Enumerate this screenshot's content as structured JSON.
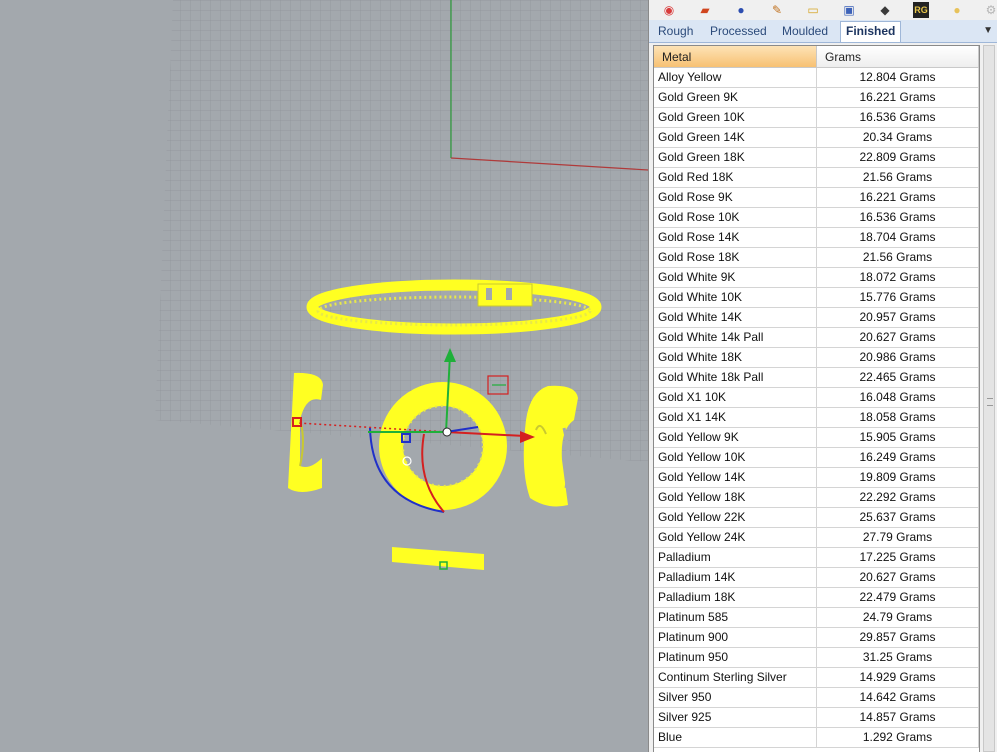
{
  "viewport": {
    "background": "#a3a8ad",
    "grid_color": "#8f9499",
    "object_color": "#ffff22"
  },
  "toolbar": {
    "icons": [
      {
        "name": "color-wheel-icon",
        "glyph": "◉",
        "color": "#d83b3b"
      },
      {
        "name": "box-icon",
        "glyph": "▰",
        "color": "#d0451e"
      },
      {
        "name": "sphere-render-icon",
        "glyph": "●",
        "color": "#2c4db0"
      },
      {
        "name": "paint-brush-icon",
        "glyph": "✎",
        "color": "#c0711e"
      },
      {
        "name": "folder-icon",
        "glyph": "▭",
        "color": "#d6a628"
      },
      {
        "name": "monitor-icon",
        "glyph": "▣",
        "color": "#3d62b8"
      },
      {
        "name": "gem-icon",
        "glyph": "◆",
        "color": "#3a3a3a"
      },
      {
        "name": "rg-logo-icon",
        "glyph": "RG",
        "color": "#e8c64a"
      },
      {
        "name": "gold-sphere-icon",
        "glyph": "●",
        "color": "#e7c25a"
      },
      {
        "name": "settings-icon",
        "glyph": "⚙",
        "color": "#b5b5b5"
      }
    ]
  },
  "tabs": [
    {
      "label": "Rough",
      "active": false
    },
    {
      "label": "Processed",
      "active": false
    },
    {
      "label": "Moulded",
      "active": false
    },
    {
      "label": "Finished",
      "active": true
    }
  ],
  "table": {
    "columns": [
      "Metal",
      "Grams"
    ],
    "rows": [
      [
        "Alloy Yellow",
        "12.804 Grams"
      ],
      [
        "Gold Green 9K",
        "16.221 Grams"
      ],
      [
        "Gold Green 10K",
        "16.536 Grams"
      ],
      [
        "Gold Green 14K",
        "20.34 Grams"
      ],
      [
        "Gold Green 18K",
        "22.809 Grams"
      ],
      [
        "Gold Red 18K",
        "21.56 Grams"
      ],
      [
        "Gold Rose 9K",
        "16.221 Grams"
      ],
      [
        "Gold Rose 10K",
        "16.536 Grams"
      ],
      [
        "Gold Rose 14K",
        "18.704 Grams"
      ],
      [
        "Gold Rose 18K",
        "21.56 Grams"
      ],
      [
        "Gold White 9K",
        "18.072 Grams"
      ],
      [
        "Gold White 10K",
        "15.776 Grams"
      ],
      [
        "Gold White 14K",
        "20.957 Grams"
      ],
      [
        "Gold White 14k Pall",
        "20.627 Grams"
      ],
      [
        "Gold White 18K",
        "20.986 Grams"
      ],
      [
        "Gold White 18k Pall",
        "22.465 Grams"
      ],
      [
        "Gold X1 10K",
        "16.048 Grams"
      ],
      [
        "Gold X1 14K",
        "18.058 Grams"
      ],
      [
        "Gold Yellow 9K",
        "15.905 Grams"
      ],
      [
        "Gold Yellow 10K",
        "16.249 Grams"
      ],
      [
        "Gold Yellow 14K",
        "19.809 Grams"
      ],
      [
        "Gold Yellow 18K",
        "22.292 Grams"
      ],
      [
        "Gold Yellow 22K",
        "25.637 Grams"
      ],
      [
        "Gold Yellow 24K",
        "27.79 Grams"
      ],
      [
        "Palladium",
        "17.225 Grams"
      ],
      [
        "Palladium 14K",
        "20.627 Grams"
      ],
      [
        "Palladium 18K",
        "22.479 Grams"
      ],
      [
        "Platinum 585",
        "24.79 Grams"
      ],
      [
        "Platinum 900",
        "29.857 Grams"
      ],
      [
        "Platinum 950",
        "31.25 Grams"
      ],
      [
        "Continum Sterling Silver",
        "14.929 Grams"
      ],
      [
        "Silver 950",
        "14.642 Grams"
      ],
      [
        "Silver 925",
        "14.857 Grams"
      ],
      [
        "Blue",
        "1.292 Grams"
      ]
    ]
  }
}
